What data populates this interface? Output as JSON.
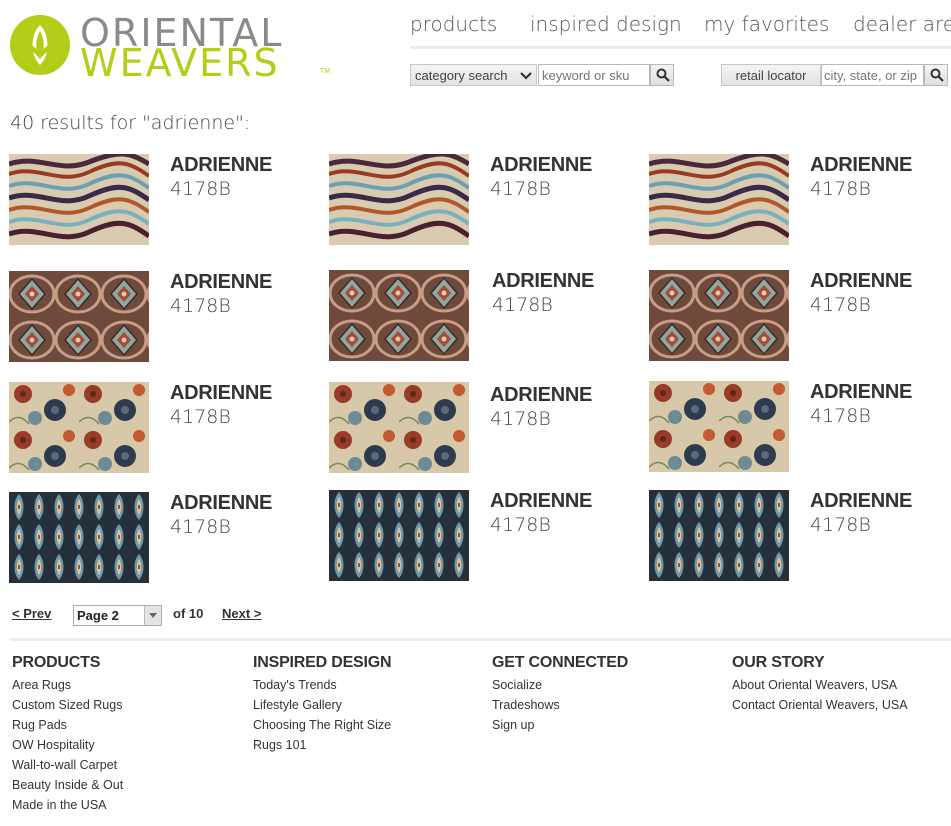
{
  "brand": {
    "line1": "ORIENTAL",
    "line2": "WEAVERS",
    "tm": "TM",
    "green": "#b5cc18",
    "gray": "#8a8a8a"
  },
  "nav": [
    "products",
    "inspired design",
    "my favorites",
    "dealer area"
  ],
  "search": {
    "category_label": "category search",
    "keyword_placeholder": "keyword or sku",
    "retail_label": "retail locator",
    "location_placeholder": "city, state, or zip"
  },
  "results_text": "40 results for \"adrienne\":",
  "products": [
    {
      "name": "ADRIENNE",
      "sku": "4178B",
      "pattern": "waves"
    },
    {
      "name": "ADRIENNE",
      "sku": "4178B",
      "pattern": "waves"
    },
    {
      "name": "ADRIENNE",
      "sku": "4178B",
      "pattern": "waves"
    },
    {
      "name": "ADRIENNE",
      "sku": "4178B",
      "pattern": "medallion"
    },
    {
      "name": "ADRIENNE",
      "sku": "4178B",
      "pattern": "medallion"
    },
    {
      "name": "ADRIENNE",
      "sku": "4178B",
      "pattern": "medallion"
    },
    {
      "name": "ADRIENNE",
      "sku": "4178B",
      "pattern": "floral"
    },
    {
      "name": "ADRIENNE",
      "sku": "4178B",
      "pattern": "floral"
    },
    {
      "name": "ADRIENNE",
      "sku": "4178B",
      "pattern": "floral"
    },
    {
      "name": "ADRIENNE",
      "sku": "4178B",
      "pattern": "ikat"
    },
    {
      "name": "ADRIENNE",
      "sku": "4178B",
      "pattern": "ikat"
    },
    {
      "name": "ADRIENNE",
      "sku": "4178B",
      "pattern": "ikat"
    }
  ],
  "pagination": {
    "prev": "< Prev",
    "page_value": "Page 2",
    "of": "of 10",
    "next": "Next >"
  },
  "footer": {
    "products": {
      "title": "PRODUCTS",
      "links": [
        "Area Rugs",
        "Custom Sized Rugs",
        "Rug Pads",
        "OW Hospitality",
        "Wall-to-wall Carpet",
        "Beauty Inside & Out",
        "Made in the USA"
      ]
    },
    "inspired": {
      "title": "INSPIRED DESIGN",
      "links": [
        "Today's Trends",
        "Lifestyle Gallery",
        "Choosing The Right Size",
        "Rugs 101"
      ]
    },
    "connected": {
      "title": "GET CONNECTED",
      "links": [
        "Socialize",
        "Tradeshows",
        "Sign up"
      ]
    },
    "story": {
      "title": "OUR STORY",
      "links": [
        "About Oriental Weavers, USA",
        "Contact Oriental Weavers, USA"
      ]
    }
  }
}
